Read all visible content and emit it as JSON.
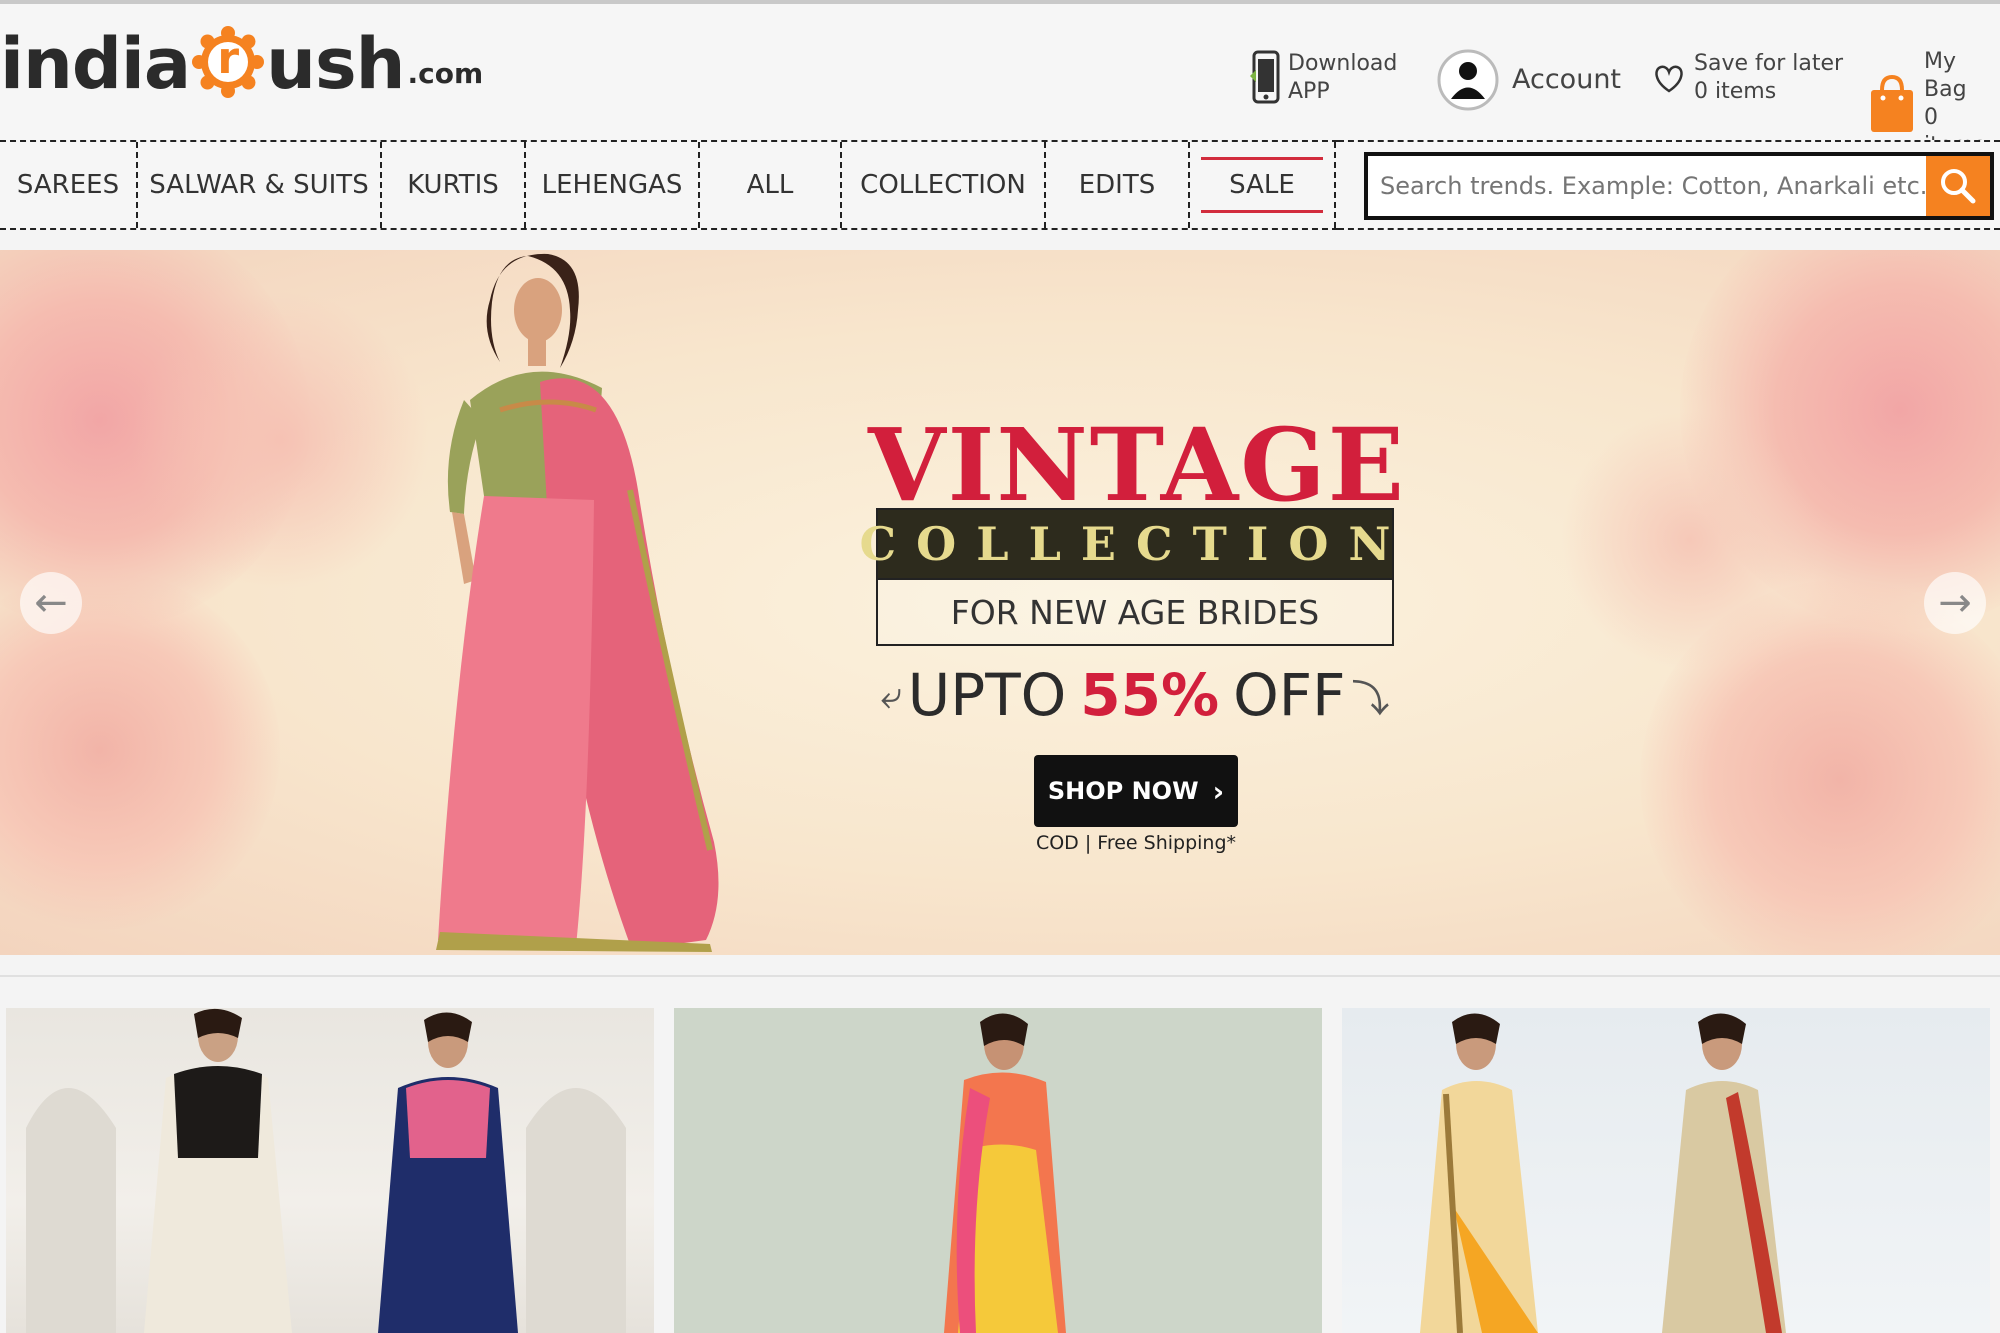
{
  "header": {
    "logo": {
      "left": "india",
      "badge_letter": "r",
      "right": "ush",
      "suffix": ".com"
    },
    "download": {
      "line1": "Download",
      "line2": "APP"
    },
    "account": {
      "label": "Account"
    },
    "save_later": {
      "line1": "Save for later",
      "line2": "0 items"
    },
    "bag": {
      "line1": "My Bag",
      "line2": "0 items"
    }
  },
  "nav": {
    "items": [
      {
        "label": "SAREES"
      },
      {
        "label": "SALWAR & SUITS"
      },
      {
        "label": "KURTIS"
      },
      {
        "label": "LEHENGAS"
      },
      {
        "label": "ALL"
      },
      {
        "label": "COLLECTION"
      },
      {
        "label": "EDITS"
      },
      {
        "label": "SALE"
      }
    ]
  },
  "search": {
    "placeholder": "Search trends. Example: Cotton, Anarkali etc..."
  },
  "banner": {
    "title": "VINTAGE",
    "subtitle": "COLLECTION",
    "tagline": "FOR NEW AGE BRIDES",
    "offer_prefix": "UPTO",
    "offer_value": "55%",
    "offer_suffix": "OFF",
    "cta": "SHOP NOW",
    "note": "COD | Free Shipping*"
  },
  "icons": {
    "search": "search-icon",
    "phone": "phone-icon",
    "account": "user-icon",
    "heart": "heart-icon",
    "bag": "shopping-bag-icon",
    "prev": "arrow-left-icon",
    "next": "arrow-right-icon"
  },
  "colors": {
    "brand_orange": "#f58220",
    "sale_red": "#d22c3d",
    "banner_red": "#d21f3c"
  }
}
